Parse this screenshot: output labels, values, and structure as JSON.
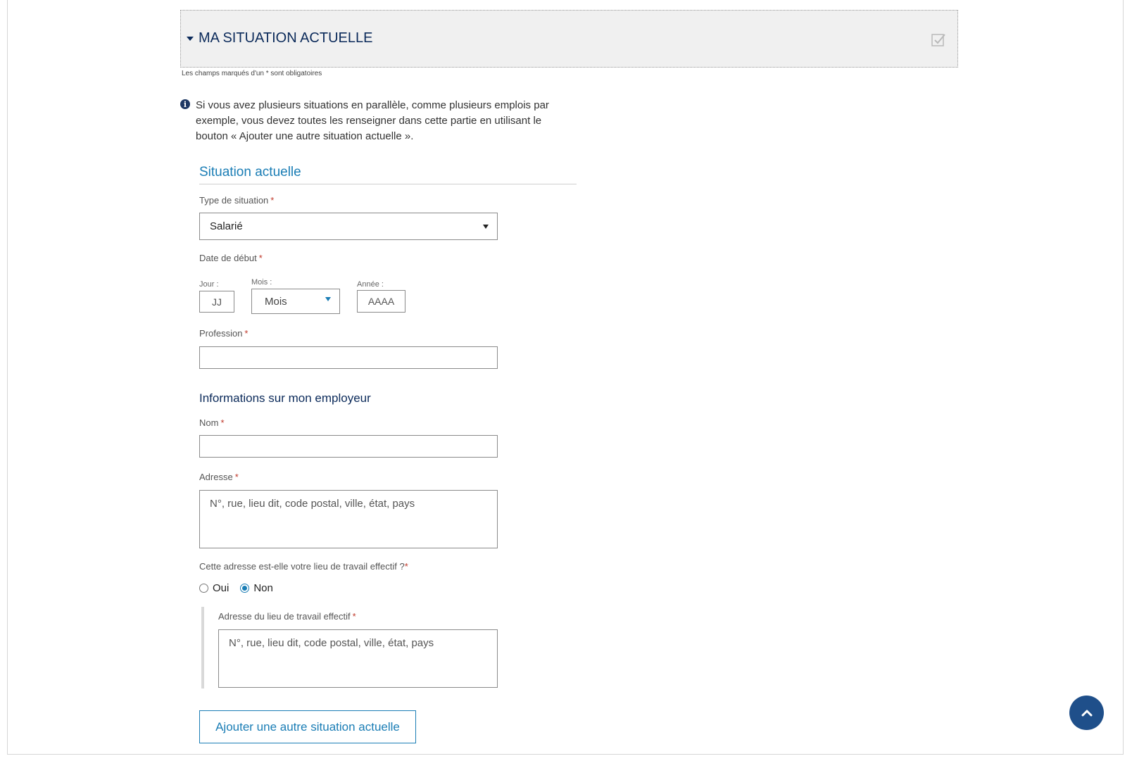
{
  "section": {
    "title": "MA SITUATION ACTUELLE",
    "required_note": "Les champs marqués d'un * sont obligatoires"
  },
  "info": {
    "text": "Si vous avez plusieurs situations en parallèle, comme plusieurs emplois par exemple, vous devez toutes les renseigner dans cette partie en utilisant le bouton « Ajouter une autre situation actuelle »."
  },
  "current_situation": {
    "title": "Situation actuelle",
    "type_label": "Type de situation",
    "type_value": "Salarié",
    "start_date_label": "Date de début",
    "day_label": "Jour :",
    "day_placeholder": "JJ",
    "month_label": "Mois :",
    "month_value": "Mois",
    "year_label": "Année :",
    "year_placeholder": "AAAA",
    "profession_label": "Profession"
  },
  "employer": {
    "title": "Informations sur mon employeur",
    "name_label": "Nom",
    "address_label": "Adresse",
    "address_placeholder": "N°, rue, lieu dit, code postal, ville, état, pays",
    "workplace_question": "Cette adresse est-elle votre lieu de travail effectif ?",
    "options": [
      "Oui",
      "Non"
    ],
    "selected_option": "Non",
    "workplace_address_label": "Adresse du lieu de travail effectif",
    "workplace_address_placeholder": "N°, rue, lieu dit, code postal, ville, état, pays"
  },
  "actions": {
    "add_button": "Ajouter une autre situation actuelle"
  },
  "required_marker": "*",
  "colors": {
    "accent": "#1a7db5",
    "heading": "#0b2a5a",
    "required": "#c0392b",
    "scroll_button": "#1f4f8a"
  },
  "icons": {
    "section_toggle": "caret-down-icon",
    "completion": "checkbox-check-icon",
    "info": "info-circle-icon",
    "scroll_top": "chevron-up-icon"
  }
}
